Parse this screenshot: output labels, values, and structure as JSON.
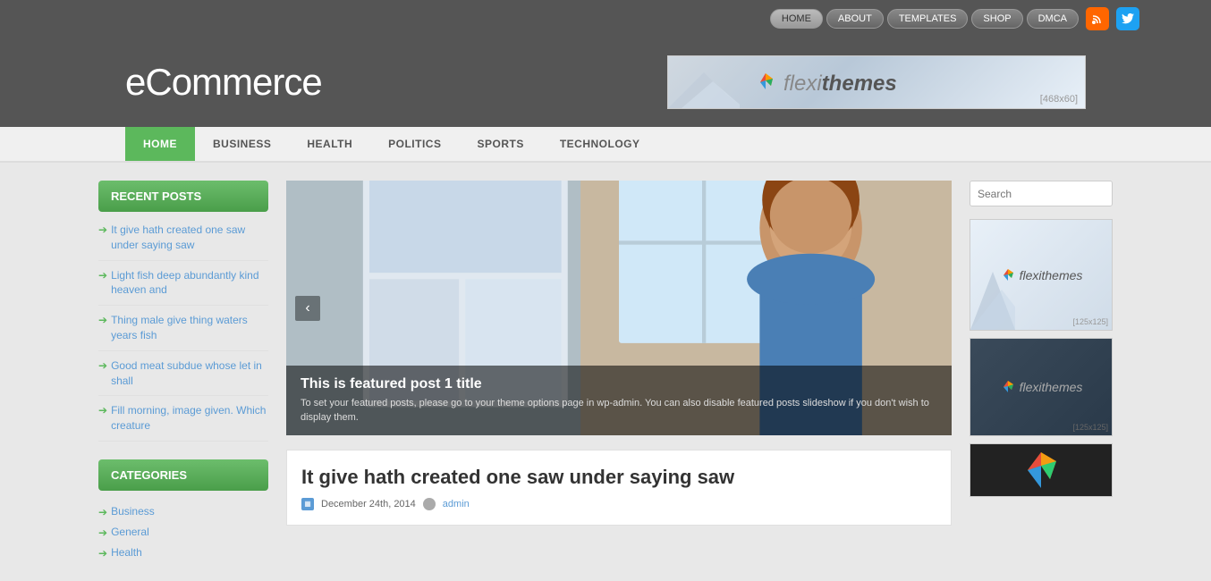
{
  "site": {
    "title": "eCommerce"
  },
  "topnav": {
    "items": [
      {
        "label": "HOME",
        "active": true
      },
      {
        "label": "ABOUT",
        "active": false
      },
      {
        "label": "TEMPLATES",
        "active": false
      },
      {
        "label": "SHOP",
        "active": false
      },
      {
        "label": "DMCA",
        "active": false
      }
    ],
    "rss_label": "RSS",
    "twitter_label": "Twitter"
  },
  "banner": {
    "brand": "flexithemes",
    "size": "[468x60]"
  },
  "mainnav": {
    "items": [
      {
        "label": "HOME",
        "active": true
      },
      {
        "label": "BUSINESS",
        "active": false
      },
      {
        "label": "HEALTH",
        "active": false
      },
      {
        "label": "POLITICS",
        "active": false
      },
      {
        "label": "SPORTS",
        "active": false
      },
      {
        "label": "TECHNOLOGY",
        "active": false
      }
    ]
  },
  "sidebar": {
    "recent_posts_title": "RECENT POSTS",
    "posts": [
      {
        "text": "It give hath created one saw under saying saw"
      },
      {
        "text": "Light fish deep abundantly kind heaven and"
      },
      {
        "text": "Thing male give thing waters years fish"
      },
      {
        "text": "Good meat subdue whose let in shall"
      },
      {
        "text": "Fill morning, image given. Which creature"
      }
    ],
    "categories_title": "CATEGORIES",
    "categories": [
      {
        "label": "Business"
      },
      {
        "label": "General"
      },
      {
        "label": "Health"
      }
    ]
  },
  "featured": {
    "title": "This is featured post 1 title",
    "description": "To set your featured posts, please go to your theme options page in wp-admin. You can also disable featured posts slideshow if you don't wish to display them."
  },
  "post": {
    "title": "It give hath created one saw under saying saw",
    "date": "December 24th, 2014",
    "author": "admin"
  },
  "search": {
    "placeholder": "Search"
  },
  "ads": [
    {
      "brand": "flexithemes",
      "size": "[125x125]"
    },
    {
      "brand": "flexithemes",
      "size": "[125x125]"
    }
  ]
}
